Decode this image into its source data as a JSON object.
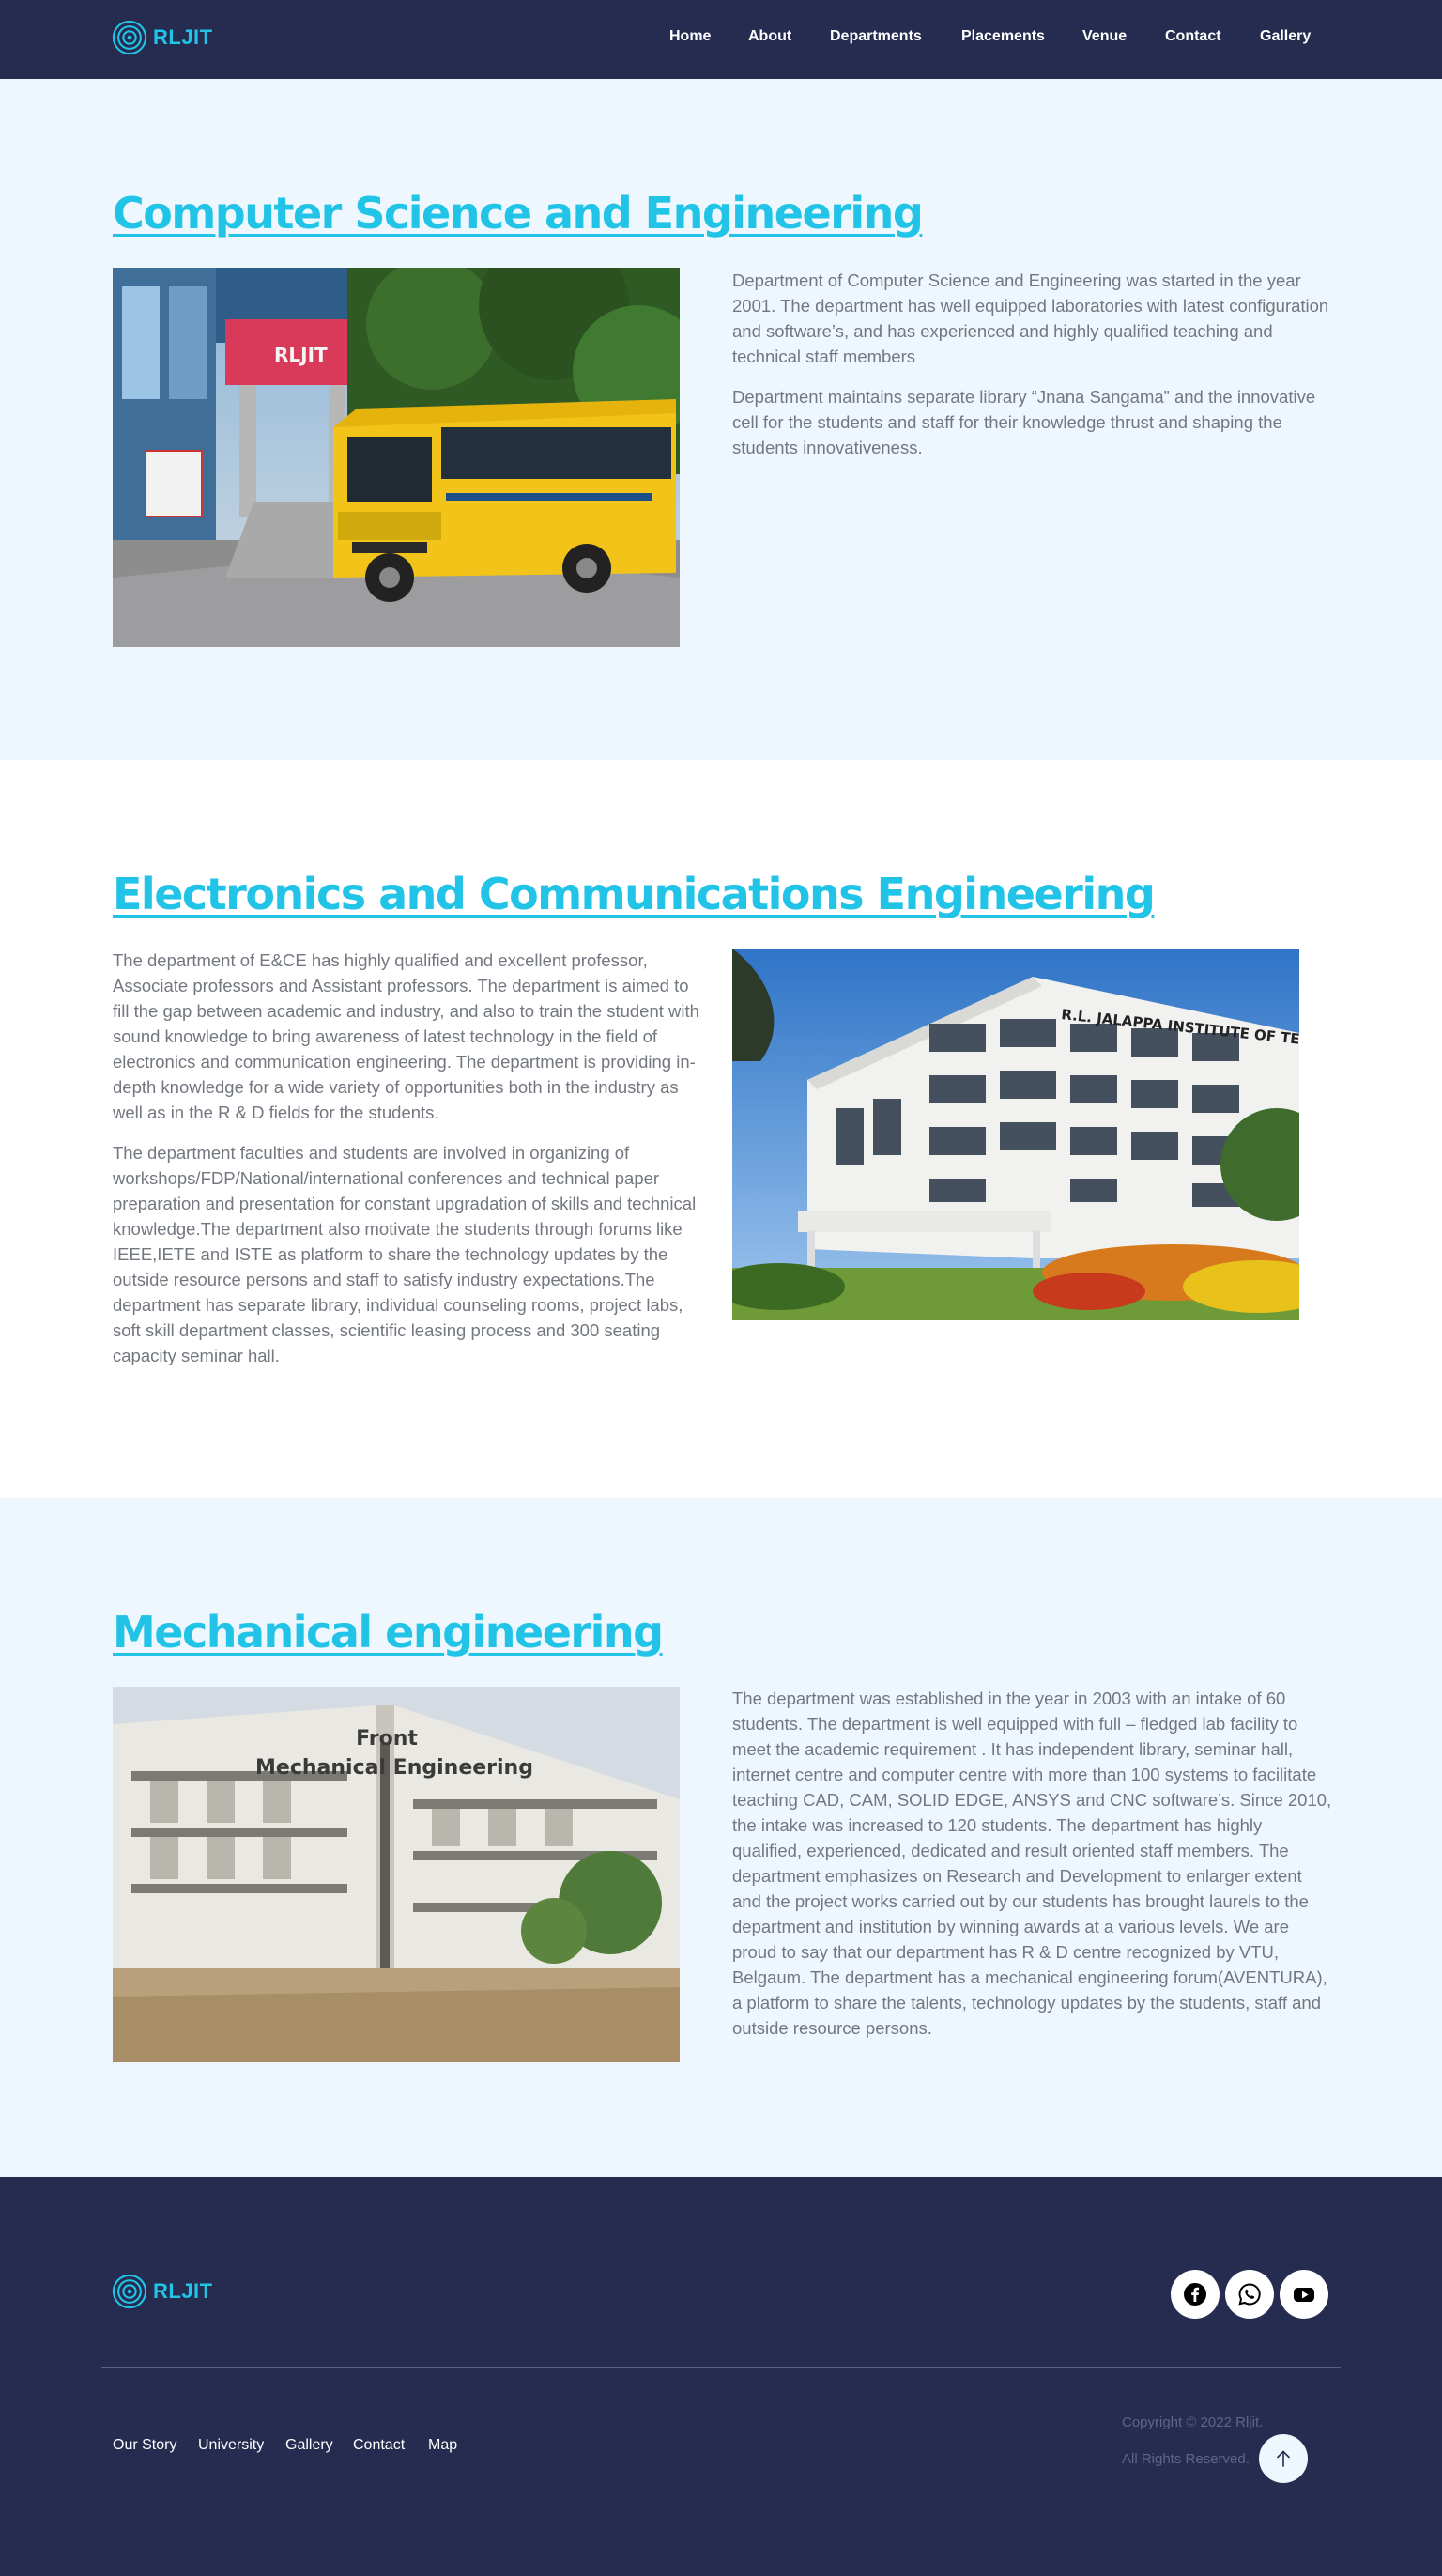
{
  "brand": {
    "name": "RLJIT",
    "color": "#21c3e6"
  },
  "nav": {
    "items": [
      "Home",
      "About",
      "Departments",
      "Placements",
      "Venue",
      "Contact",
      "Gallery"
    ]
  },
  "sections": [
    {
      "title": "Computer Science and Engineering",
      "paragraphs": [
        "Department of Computer Science and Engineering was started in the year 2001. The department has well equipped laboratories with latest configuration and software’s, and has experienced and highly qualified teaching and technical staff members",
        "Department maintains separate library “Jnana Sangama” and the innovative cell for the students and staff for their knowledge thrust and shaping the students innovativeness."
      ],
      "image_sign": "RLJIT"
    },
    {
      "title": "Electronics and Communications Engineering",
      "paragraphs": [
        "The department of E&CE has highly qualified and excellent professor, Associate professors and Assistant professors. The department is aimed to fill the gap between academic and industry, and also to train the student with sound knowledge to bring awareness of latest technology in the field of electronics and communication engineering. The department is providing in-depth knowledge for a wide variety of opportunities both in the industry as well as in the R & D fields for the students.",
        "The department faculties and students are involved in organizing of workshops/FDP/National/international conferences and technical paper preparation and presentation for constant upgradation of skills and technical knowledge.The department also motivate the students through forums like IEEE,IETE and ISTE as platform to share the technology updates by the outside resource persons and staff to satisfy industry expectations.The department has separate library, individual counseling rooms, project labs, soft skill department classes, scientific leasing process and 300 seating capacity seminar hall."
      ],
      "image_sign": "R.L. JALAPPA INSTITUTE OF TECH"
    },
    {
      "title": "Mechanical engineering",
      "paragraphs": [
        "The department was established in the year in 2003 with an intake of 60 students. The department is well equipped with full – fledged lab facility to meet the academic requirement . It has independent library, seminar hall, internet centre and computer centre with more than 100 systems to facilitate teaching CAD, CAM, SOLID EDGE, ANSYS and CNC software’s. Since 2010, the intake was increased to 120 students. The department has highly qualified, experienced, dedicated and result oriented staff members. The department emphasizes on Research and Development to enlarger extent and the project works carried out by our students has brought laurels to the department and institution by winning awards at a various levels. We are proud to say that our department has R & D centre recognized by VTU, Belgaum. The department has a mechanical engineering forum(AVENTURA), a platform to share the talents, technology updates by the students, staff and outside resource persons."
      ],
      "image_caption": [
        "Front",
        "Mechanical Engineering"
      ]
    }
  ],
  "footer": {
    "social": [
      "facebook-icon",
      "whatsapp-icon",
      "youtube-icon"
    ],
    "links": [
      "Our Story",
      "University",
      "Gallery",
      "Contact",
      "Map"
    ],
    "copyright": "Copyright © 2022 Rljit.",
    "rights": "All Rights Reserved."
  },
  "colors": {
    "navy": "#262c50",
    "accent": "#21c3e6",
    "light_bg": "#eef7fd"
  }
}
